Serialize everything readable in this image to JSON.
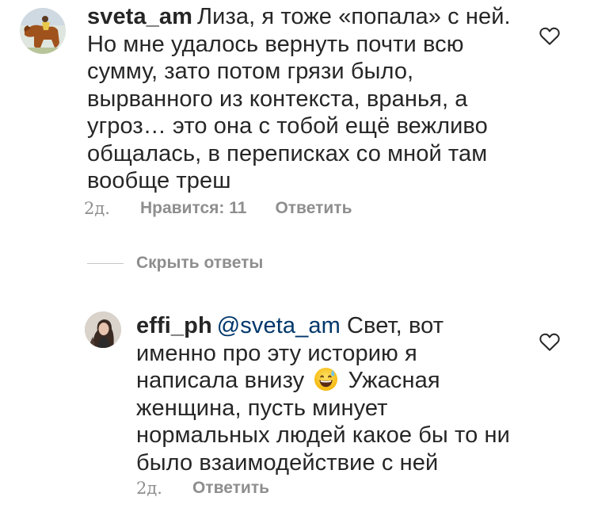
{
  "comment1": {
    "username": "sveta_am",
    "text_lines": [
      "Лиза, я тоже «попала» с ней.",
      "Но мне удалось вернуть почти всю",
      "сумму, зато потом грязи было,",
      "вырванного из контекста, вранья, а",
      "угроз… это она с тобой ещё вежливо",
      "общалась, в переписках со мной там",
      "вообще треш"
    ],
    "time": "2д.",
    "likes": "Нравится: 11",
    "reply": "Ответить",
    "avatar_icon": "horse-rider-avatar",
    "like_icon": "heart-outline-icon"
  },
  "hide_replies": {
    "label": "Скрыть ответы"
  },
  "comment2": {
    "username": "effi_ph",
    "mention": "@sveta_am",
    "line1_rest": "Свет, вот",
    "line2": "именно про эту историю я",
    "line3_before": "написала внизу",
    "line3_after": "Ужасная",
    "line4": "женщина, пусть минует",
    "line5": "нормальных людей какое бы то ни",
    "line6": "было взаимодействие с ней",
    "emoji_icon": "grinning-sweat-emoji",
    "time": "2д.",
    "reply": "Ответить",
    "avatar_icon": "woman-portrait-avatar",
    "like_icon": "heart-outline-icon"
  },
  "colors": {
    "text": "#262626",
    "secondary": "#8e8e8e",
    "mention": "#00376b",
    "divider": "#c7c7c7"
  }
}
